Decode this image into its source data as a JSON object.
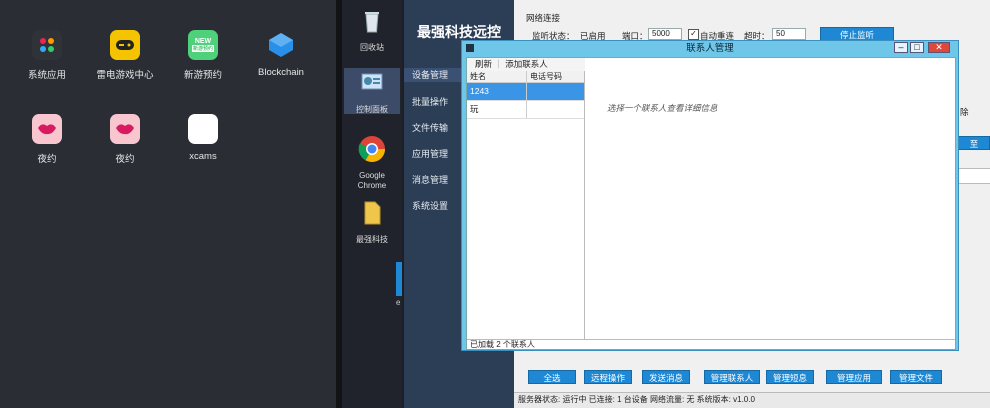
{
  "phone": {
    "apps": [
      {
        "label": "系统应用",
        "icon": "apps-grid-icon",
        "color": "#2f3338"
      },
      {
        "label": "雷电游戏中心",
        "icon": "gamepad-icon",
        "color": "#f5c400"
      },
      {
        "label": "新游预约",
        "icon": "new-badge-icon",
        "color": "#4fd07a",
        "badge": "NEW",
        "sub": "新游预约"
      },
      {
        "label": "Blockchain",
        "icon": "blockchain-cube-icon",
        "color": "#2a8fe8"
      },
      {
        "label": "夜约",
        "icon": "lips-icon",
        "color": "#f7c6cf"
      },
      {
        "label": "夜约",
        "icon": "lips-icon",
        "color": "#f7c6cf"
      },
      {
        "label": "xcams",
        "icon": "blank-white-icon",
        "color": "#ffffff"
      }
    ]
  },
  "desktop": {
    "icons": [
      {
        "label": "回收站",
        "icon": "recycle-bin-icon"
      },
      {
        "label": "控制面板",
        "icon": "control-panel-icon"
      },
      {
        "label": "Google Chrome",
        "icon": "chrome-icon"
      },
      {
        "label": "最强科技",
        "icon": "folder-icon"
      }
    ],
    "stray_label": "e"
  },
  "app": {
    "brand": "最强科技远控",
    "nav": [
      "设备管理",
      "批量操作",
      "文件传输",
      "应用管理",
      "消息管理",
      "系统设置"
    ],
    "network": {
      "section": "网络连接",
      "status_label": "监听状态：",
      "status_value": "已启用",
      "port_label": "端口：",
      "port_value": "5000",
      "auto_label": "自动重连",
      "timeout_label": "超时：",
      "timeout_value": "50",
      "stop_button": "停止监听"
    },
    "right_fragment": "除",
    "right_fragment2": "至",
    "bottom_buttons": [
      "全选",
      "远程操作",
      "发送消息",
      "管理联系人",
      "管理短息",
      "管理应用",
      "管理文件"
    ],
    "statusbar": "服务器状态: 运行中  已连接: 1 台设备  网络流量: 无  系统版本: v1.0.0"
  },
  "dialog": {
    "title": "联系人管理",
    "toolbar": {
      "refresh": "刷新",
      "add": "添加联系人"
    },
    "columns": [
      "姓名",
      "电话号码"
    ],
    "rows": [
      {
        "name": "1243",
        "phone": "",
        "selected": true
      },
      {
        "name": "玩",
        "phone": "",
        "selected": false
      }
    ],
    "hint": "选择一个联系人查看详细信息",
    "status": "已加载 2 个联系人"
  }
}
